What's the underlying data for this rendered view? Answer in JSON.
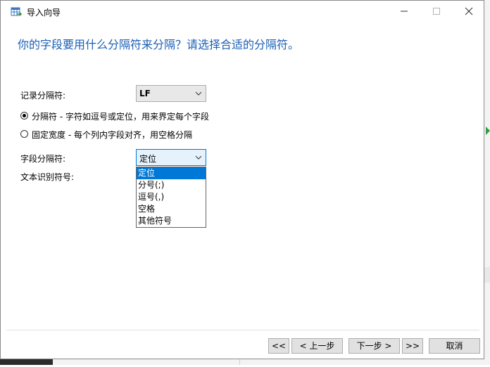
{
  "window": {
    "title": "导入向导",
    "icon": "table-import-icon"
  },
  "heading": "你的字段要用什么分隔符来分隔？请选择合适的分隔符。",
  "record_separator": {
    "label": "记录分隔符:",
    "value": "LF"
  },
  "format_options": [
    {
      "label": "分隔符 - 字符如逗号或定位，用来界定每个字段",
      "selected": true
    },
    {
      "label": "固定宽度 - 每个列内字段对齐，用空格分隔",
      "selected": false
    }
  ],
  "field_separator": {
    "label": "字段分隔符:",
    "value": "定位",
    "options": [
      "定位",
      "分号(;)",
      "逗号(,)",
      "空格",
      "其他符号"
    ],
    "selected_index": 0
  },
  "text_qualifier": {
    "label": "文本识别符号:"
  },
  "buttons": {
    "first": "<<",
    "prev": "< 上一步",
    "next": "下一步 >",
    "last": ">>",
    "cancel": "取消"
  },
  "colors": {
    "heading": "#1a5fb4",
    "selection": "#0078d7"
  }
}
